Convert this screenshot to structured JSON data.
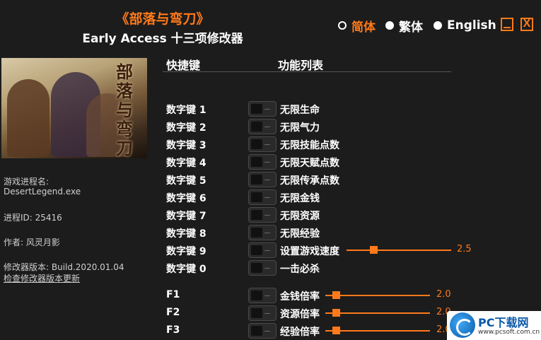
{
  "header": {
    "game_title": "《部落与弯刀》",
    "subtitle": "Early Access 十三项修改器"
  },
  "languages": [
    {
      "label": "简体",
      "selected": true
    },
    {
      "label": "繁体",
      "selected": false
    },
    {
      "label": "English",
      "selected": false
    }
  ],
  "window_controls": {
    "close_label": "X"
  },
  "cover_image": {
    "logo_text": "部落与弯刀"
  },
  "info": {
    "process_label": "游戏进程名:",
    "process_name": "DesertLegend.exe",
    "pid": "进程ID: 25416",
    "author": "作者: 风灵月影",
    "version": "修改器版本: Build.2020.01.04",
    "update_link": "检查修改器版本更新"
  },
  "columns": {
    "hotkey": "快捷键",
    "features": "功能列表"
  },
  "cheats": [
    {
      "key": "数字键 1",
      "label": "无限生命"
    },
    {
      "key": "数字键 2",
      "label": "无限气力"
    },
    {
      "key": "数字键 3",
      "label": "无限技能点数"
    },
    {
      "key": "数字键 4",
      "label": "无限天赋点数"
    },
    {
      "key": "数字键 5",
      "label": "无限传承点数"
    },
    {
      "key": "数字键 6",
      "label": "无限金钱"
    },
    {
      "key": "数字键 7",
      "label": "无限资源"
    },
    {
      "key": "数字键 8",
      "label": "无限经验"
    },
    {
      "key": "数字键 9",
      "label": "设置游戏速度",
      "slider_value": "2.5"
    },
    {
      "key": "数字键 0",
      "label": "一击必杀"
    },
    {
      "key": "F1",
      "label": "金钱倍率",
      "slider_value": "2.0"
    },
    {
      "key": "F2",
      "label": "资源倍率",
      "slider_value": "2.0"
    },
    {
      "key": "F3",
      "label": "经验倍率",
      "slider_value": "2.0"
    }
  ],
  "watermark": {
    "title": "PC下载网",
    "url": "www.pcsoft.com.cn"
  },
  "colors": {
    "accent": "#ff7a1a",
    "background": "#1c1c1c",
    "text": "#ffffff"
  }
}
